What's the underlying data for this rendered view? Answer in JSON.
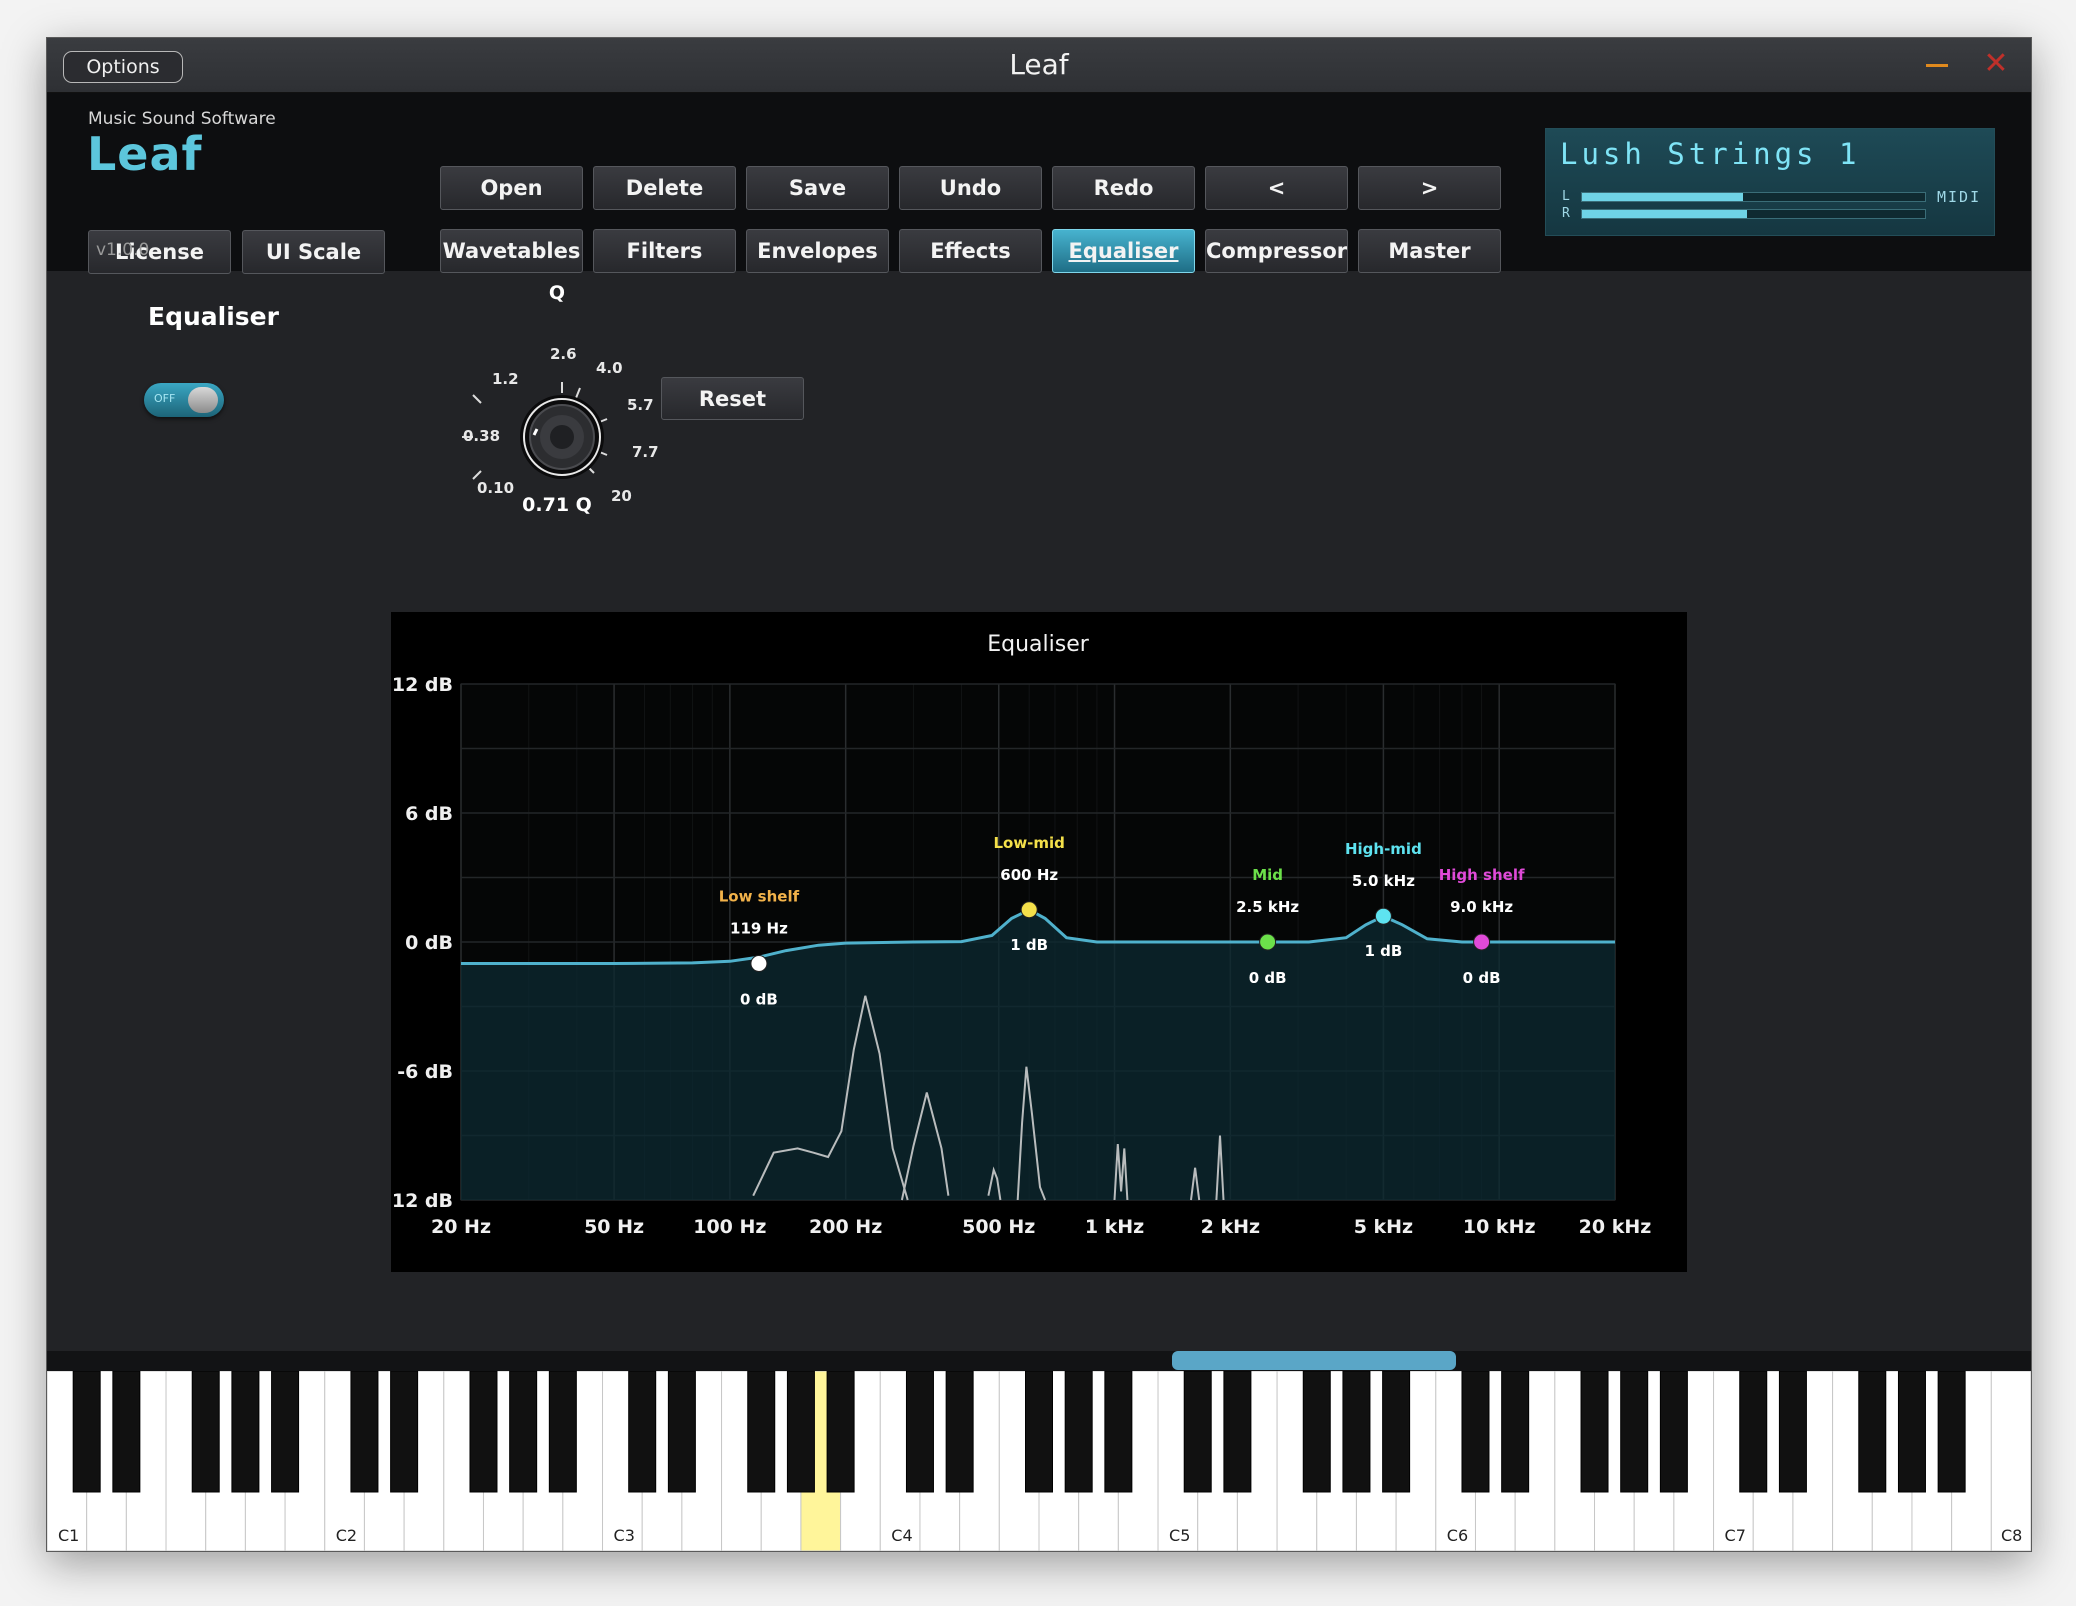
{
  "window": {
    "title": "Leaf",
    "options_label": "Options",
    "close_glyph": "✕"
  },
  "brand": {
    "company": "Music Sound Software",
    "logo": "Leaf",
    "version": "v1.0.0"
  },
  "header": {
    "license_label": "License",
    "ui_scale_label": "UI Scale",
    "file_buttons": [
      "Open",
      "Delete",
      "Save",
      "Undo",
      "Redo",
      "<",
      ">"
    ],
    "page_tabs": [
      "Wavetables",
      "Filters",
      "Envelopes",
      "Effects",
      "Equaliser",
      "Compressor",
      "Master"
    ],
    "active_tab": "Equaliser"
  },
  "display": {
    "preset_name": "Lush Strings 1",
    "left_label": "L",
    "right_label": "R",
    "midi_label": "MIDI",
    "level_left": 0.47,
    "level_right": 0.48
  },
  "equaliser": {
    "section_title": "Equaliser",
    "toggle_label": "OFF",
    "toggle_on": false,
    "q_label": "Q",
    "q_value_text": "0.71 Q",
    "q_ticks": [
      "0.10",
      "0.38",
      "1.2",
      "2.6",
      "4.0",
      "5.7",
      "7.7",
      "20"
    ],
    "reset_label": "Reset"
  },
  "colors": {
    "accent": "#5cc6dc",
    "curve": "#4fb1cc",
    "low_shelf": "#f2b24a",
    "low_mid": "#f4e04a",
    "mid": "#6ce04a",
    "high_mid": "#5ee3f0",
    "high_shelf": "#e04ad8"
  },
  "chart_data": {
    "type": "line",
    "title": "Equaliser",
    "x_scale": "log",
    "xlim": [
      20,
      20000
    ],
    "ylim": [
      -12,
      12
    ],
    "x_ticks": [
      20,
      50,
      100,
      200,
      500,
      1000,
      2000,
      5000,
      10000,
      20000
    ],
    "x_tick_labels": [
      "20 Hz",
      "50 Hz",
      "100 Hz",
      "200 Hz",
      "500 Hz",
      "1 kHz",
      "2 kHz",
      "5 kHz",
      "10 kHz",
      "20 kHz"
    ],
    "y_ticks": [
      12,
      6,
      0,
      -6,
      -12
    ],
    "y_tick_labels": [
      "12 dB",
      "6 dB",
      "0 dB",
      "-6 dB",
      "-12 dB"
    ],
    "grid": true,
    "bands": [
      {
        "name": "Low shelf",
        "freq": 119,
        "freq_label": "119 Hz",
        "gain_label": "0 dB",
        "point_gain": -1,
        "color": "#f2b24a",
        "marker": "#ffffff",
        "gain_below": true
      },
      {
        "name": "Low-mid",
        "freq": 600,
        "freq_label": "600 Hz",
        "gain_label": "1 dB",
        "point_gain": 1.5,
        "color": "#f4e04a",
        "marker": "#f4e04a",
        "gain_below": true
      },
      {
        "name": "Mid",
        "freq": 2500,
        "freq_label": "2.5 kHz",
        "gain_label": "0 dB",
        "point_gain": 0,
        "color": "#6ce04a",
        "marker": "#6ce04a",
        "gain_below": true
      },
      {
        "name": "High-mid",
        "freq": 5000,
        "freq_label": "5.0 kHz",
        "gain_label": "1 dB",
        "point_gain": 1.2,
        "color": "#5ee3f0",
        "marker": "#5ee3f0",
        "gain_below": true
      },
      {
        "name": "High shelf",
        "freq": 9000,
        "freq_label": "9.0 kHz",
        "gain_label": "0 dB",
        "point_gain": 0,
        "color": "#e04ad8",
        "marker": "#e04ad8",
        "gain_below": true
      }
    ],
    "response_curve": {
      "x": [
        20,
        50,
        80,
        100,
        119,
        140,
        170,
        200,
        300,
        400,
        480,
        540,
        600,
        660,
        750,
        900,
        1200,
        2000,
        2500,
        3200,
        4000,
        4500,
        5000,
        5600,
        6500,
        8000,
        9000,
        12000,
        20000
      ],
      "y": [
        -1.0,
        -1.0,
        -0.97,
        -0.9,
        -0.7,
        -0.4,
        -0.15,
        -0.05,
        0,
        0.02,
        0.3,
        1.1,
        1.5,
        1.1,
        0.2,
        0,
        0,
        0,
        0,
        0,
        0.2,
        0.8,
        1.2,
        0.8,
        0.15,
        0,
        0,
        0,
        0
      ]
    },
    "spectrum": [
      {
        "x": [
          115,
          130,
          150,
          165,
          180,
          195,
          210,
          225,
          245,
          265,
          290
        ],
        "y": [
          -11.8,
          -9.8,
          -9.6,
          -9.8,
          -10.0,
          -8.8,
          -5.0,
          -2.5,
          -5.2,
          -9.6,
          -12
        ]
      },
      {
        "x": [
          280,
          300,
          325,
          355,
          370
        ],
        "y": [
          -12,
          -9.5,
          -7.0,
          -9.6,
          -11.8
        ]
      },
      {
        "x": [
          470,
          485,
          495,
          505
        ],
        "y": [
          -11.8,
          -10.6,
          -11.0,
          -12
        ]
      },
      {
        "x": [
          560,
          575,
          590,
          610,
          640,
          660
        ],
        "y": [
          -12,
          -8.4,
          -5.8,
          -8.0,
          -11.4,
          -12
        ]
      },
      {
        "x": [
          1000,
          1020,
          1040,
          1060,
          1080
        ],
        "y": [
          -12,
          -9.4,
          -11.6,
          -9.6,
          -12
        ]
      },
      {
        "x": [
          1580,
          1620,
          1660
        ],
        "y": [
          -12,
          -10.5,
          -12
        ]
      },
      {
        "x": [
          1840,
          1880,
          1920
        ],
        "y": [
          -12,
          -9.0,
          -12
        ]
      }
    ]
  },
  "piano": {
    "octave_labels": [
      "C1",
      "C2",
      "C3",
      "C4",
      "C5",
      "C6",
      "C7",
      "C8"
    ],
    "highlight_key": "C#3+D#3 region"
  }
}
